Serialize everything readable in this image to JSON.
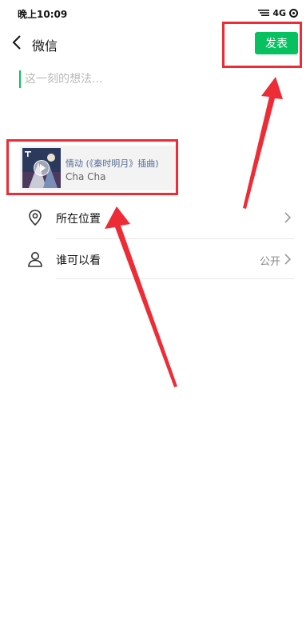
{
  "status_bar": {
    "time": "晚上10:09",
    "network": "4G",
    "icons": [
      "signal-icon",
      "alarm-icon"
    ]
  },
  "nav": {
    "back_icon": "chevron-left-icon",
    "title": "微信",
    "publish_label": "发表",
    "accent_color": "#07c160"
  },
  "composer": {
    "placeholder": "这一刻的想法..."
  },
  "music_card": {
    "title": "情动 (《秦时明月》插曲)",
    "artist": "Cha Cha",
    "title_color": "#576b95"
  },
  "options": [
    {
      "label": "所在位置",
      "value": "",
      "icon": "location-pin-icon"
    },
    {
      "label": "谁可以看",
      "value": "公开",
      "icon": "person-icon"
    }
  ],
  "annotation_color": "#ee2c35"
}
